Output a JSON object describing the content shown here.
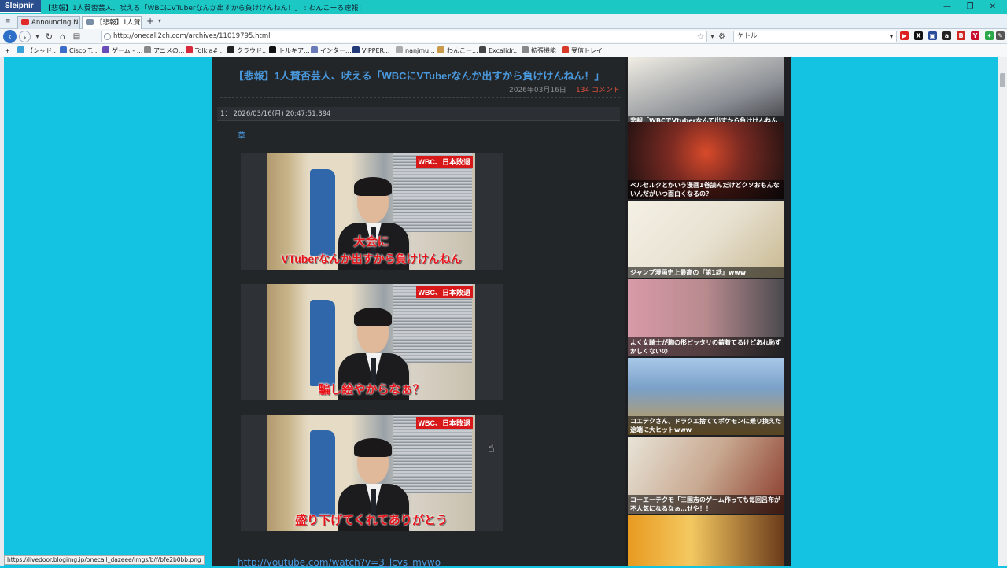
{
  "window": {
    "brand": "Sleipnir",
    "title": "【悲報】1人賛否芸人、吠える「WBCにVTuberなんか出すから負けけんねん！」 : わんこーる速報！",
    "controls": [
      "—",
      "❐",
      "✕"
    ]
  },
  "tabs": [
    {
      "label": "Announcing N...",
      "color": "#e02a2a"
    },
    {
      "label": "【悲報】1人賛否...",
      "color": "#7a8ea6",
      "active": true
    }
  ],
  "tab_add": "+",
  "tab_menu": "▾",
  "nav": {
    "back": "‹",
    "forward": "›",
    "reload": "↻",
    "home": "⌂",
    "url": "http://onecall2ch.com/archives/11019795.html",
    "search_value": "ケトル",
    "star": "☆"
  },
  "bookmarks": [
    {
      "label": "【シャド...",
      "color": "#3aa0d8"
    },
    {
      "label": "Cisco T...",
      "color": "#3a6cc8"
    },
    {
      "label": "ゲーム - ...",
      "color": "#6a4cb8"
    },
    {
      "label": "アニメの...",
      "color": "#888888"
    },
    {
      "label": "Tolkia#...",
      "color": "#d8283c"
    },
    {
      "label": "クラウド...",
      "color": "#222222"
    },
    {
      "label": "トルキア...",
      "color": "#111111"
    },
    {
      "label": "インター...",
      "color": "#6a7ab8"
    },
    {
      "label": "VIPPER...",
      "color": "#223a78"
    },
    {
      "label": "nanjmu...",
      "color": "#aaaaaa"
    },
    {
      "label": "わんこー...",
      "color": "#c89a4a"
    },
    {
      "label": "Excalidr...",
      "color": "#444444"
    },
    {
      "label": "拡張機能",
      "color": "#888888"
    },
    {
      "label": "受信トレイ",
      "color": "#d83a2a"
    }
  ],
  "toolbar_icons": [
    {
      "name": "youtube-icon",
      "glyph": "▶",
      "color": "#e02020"
    },
    {
      "name": "x-icon",
      "glyph": "X",
      "color": "#111111"
    },
    {
      "name": "video-icon",
      "glyph": "▣",
      "color": "#2a4a9a"
    },
    {
      "name": "amazon-icon",
      "glyph": "a",
      "color": "#222222"
    },
    {
      "name": "bookmark-b-icon",
      "glyph": "B",
      "color": "#d0281e"
    },
    {
      "name": "y-icon",
      "glyph": "Y",
      "color": "#c8102e"
    },
    {
      "name": "extension-icon",
      "glyph": "✦",
      "color": "#2aa84a"
    },
    {
      "name": "pencil-icon",
      "glyph": "✎",
      "color": "#555555"
    }
  ],
  "article": {
    "title": "【悲報】1人賛否芸人、吠える「WBCにVTuberなんか出すから負けけんねん！」",
    "date": "2026年03月16日",
    "comments": "134 コメント",
    "post_header": "1： 2026/03/16(月) 20:47:51.394",
    "post_body": "草",
    "images": [
      {
        "badge": "WBC、日本敗退",
        "caption_lines": [
          "大会に",
          "VTuberなんか出すから負けけんねん"
        ]
      },
      {
        "badge": "WBC、日本敗退",
        "caption_lines": [
          "",
          "騙し絵やからなぁ？"
        ]
      },
      {
        "badge": "WBC、日本敗退",
        "caption_lines": [
          "",
          "盛り下げてくれてありがとう"
        ]
      }
    ],
    "link": "http://youtube.com/watch?v=3_lcys_mywo"
  },
  "sidebar": [
    {
      "caption": "悲報「WBCでVtuberなんて出すから負けけんねんw盛り下げてくれてほんまありがとう！w！",
      "bg": "#8a8e94"
    },
    {
      "caption": "ベルセルクとかいう漫画1巻読んだけどクソおもんないんだがいつ面白くなるの？",
      "bg": "#7a2a22"
    },
    {
      "caption": "ジャンプ漫画史上最高の『第1話』www",
      "bg": "#e8e2d2"
    },
    {
      "caption": "よく女騎士が胸の形ピッタリの鎧着てるけどあれ恥ずかしくないの",
      "bg": "#b88a8e"
    },
    {
      "caption": "コエテクさん、ドラクエ捨ててポケモンに乗り換えた途端に大ヒットwww",
      "bg": "#7aa0c8"
    },
    {
      "caption": "コーエーテクモ「三国志のゲーム作っても毎回呂布が不人気になるなぁ…せや！！",
      "bg": "#c8a890"
    },
    {
      "caption": "",
      "bg": "#e89a20"
    }
  ],
  "status": "https://livedoor.blogimg.jp/onecall_dazeee/imgs/b/f/bfe2b0bb.png"
}
